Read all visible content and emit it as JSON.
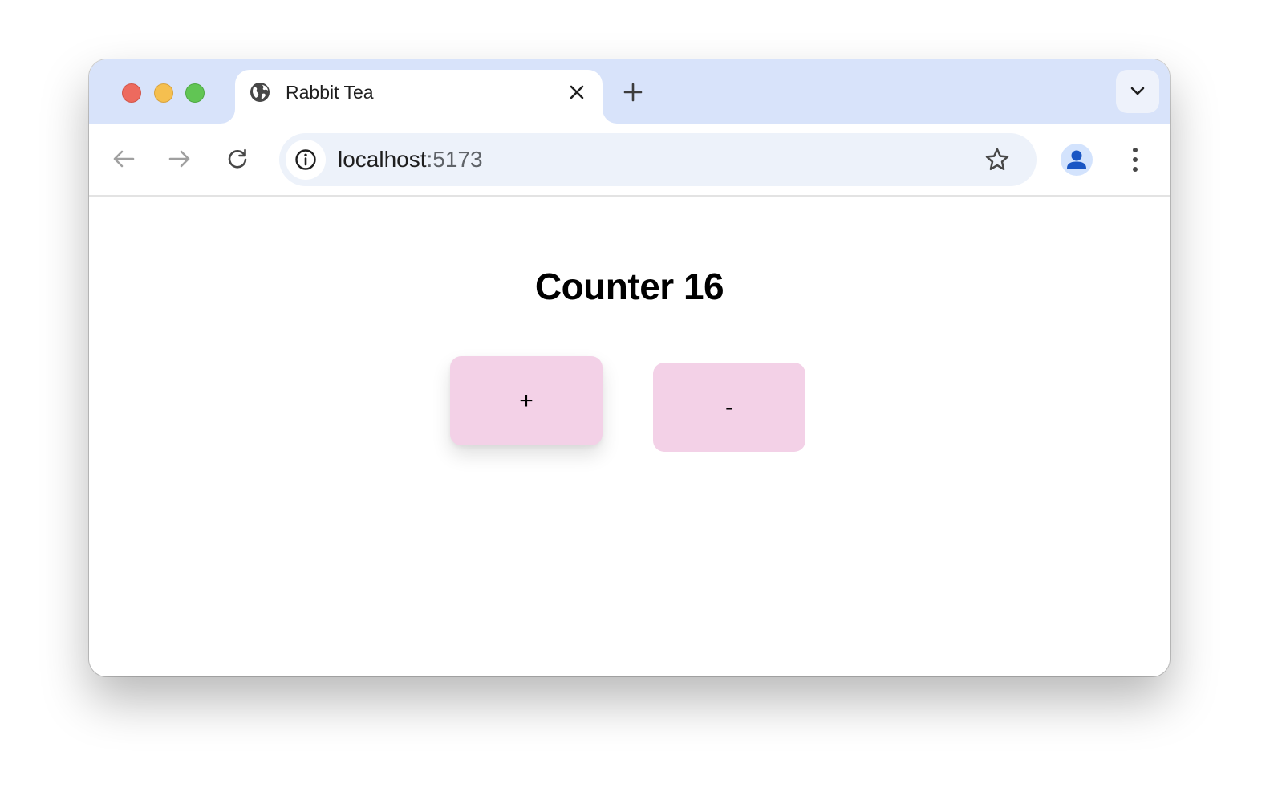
{
  "browser": {
    "tab": {
      "title": "Rabbit Tea",
      "favicon": "globe-icon"
    },
    "address_bar": {
      "host": "localhost",
      "port": ":5173"
    },
    "icons": {
      "back": "arrow-left-icon",
      "forward": "arrow-right-icon",
      "reload": "reload-icon",
      "site_info": "info-icon",
      "bookmark": "star-icon",
      "profile": "person-icon",
      "menu": "kebab-menu-icon",
      "new_tab": "plus-icon",
      "tab_search": "chevron-down-icon",
      "close_tab": "close-icon"
    },
    "colors": {
      "tabstrip": "#d8e3fa",
      "omnibox": "#edf2fa",
      "profile_accent": "#1a56c4"
    }
  },
  "page": {
    "heading": "Counter 16",
    "increment_label": "+",
    "decrement_label": "-",
    "button_color": "#f3d1e7"
  }
}
